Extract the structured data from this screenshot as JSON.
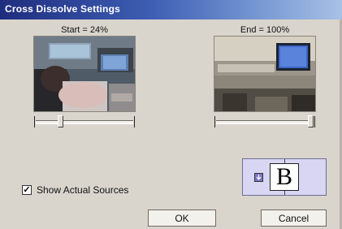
{
  "window": {
    "title": "Cross Dissolve Settings"
  },
  "start": {
    "label": "Start = 24%",
    "value_percent": 24
  },
  "end": {
    "label": "End = 100%",
    "value_percent": 100
  },
  "options": {
    "show_actual_sources_label": "Show Actual Sources",
    "show_actual_sources_checked": true,
    "check_glyph": "✓"
  },
  "preview": {
    "letter": "B"
  },
  "buttons": {
    "ok": "OK",
    "cancel": "Cancel"
  },
  "colors": {
    "titlebar_start": "#1f2d7e",
    "titlebar_end": "#a8c0e6",
    "preview_bg": "#d8d6f2"
  }
}
